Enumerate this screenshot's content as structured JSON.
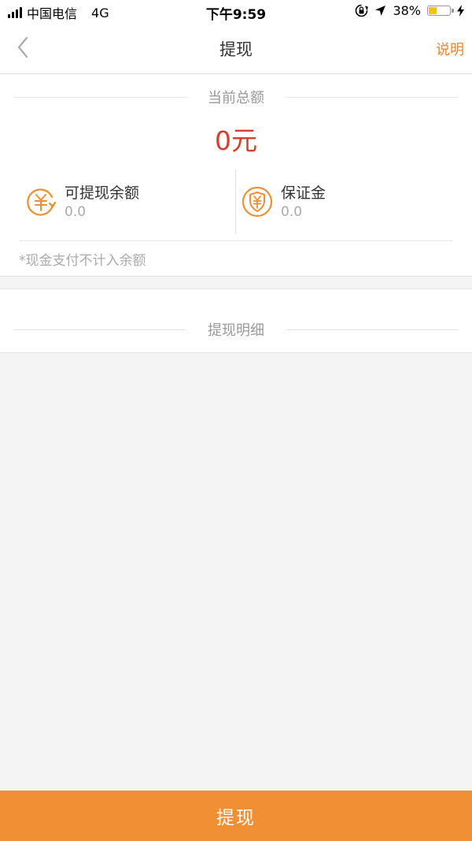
{
  "status_bar": {
    "carrier": "中国电信",
    "network": "4G",
    "time": "下午9:59",
    "battery_percent": "38%",
    "battery_level": 0.38,
    "icons": [
      "signal-icon",
      "rotation-lock-icon",
      "location-arrow-icon",
      "battery-icon",
      "charging-bolt-icon"
    ]
  },
  "nav": {
    "title": "提现",
    "help_label": "说明",
    "back_icon": "chevron-left-icon"
  },
  "summary": {
    "section_title": "当前总额",
    "total_amount": "0元",
    "items": [
      {
        "label": "可提现余额",
        "value": "0.0",
        "icon": "yuan-cycle-icon"
      },
      {
        "label": "保证金",
        "value": "0.0",
        "icon": "yuan-shield-icon"
      }
    ],
    "note": "*现金支付不计入余额"
  },
  "details": {
    "section_title": "提现明细"
  },
  "bottom_button": {
    "label": "提现"
  },
  "colors": {
    "accent": "#f08f33",
    "amount_red": "#d63d2c",
    "help_orange": "#f0862c",
    "background": "#f4f4f4"
  }
}
